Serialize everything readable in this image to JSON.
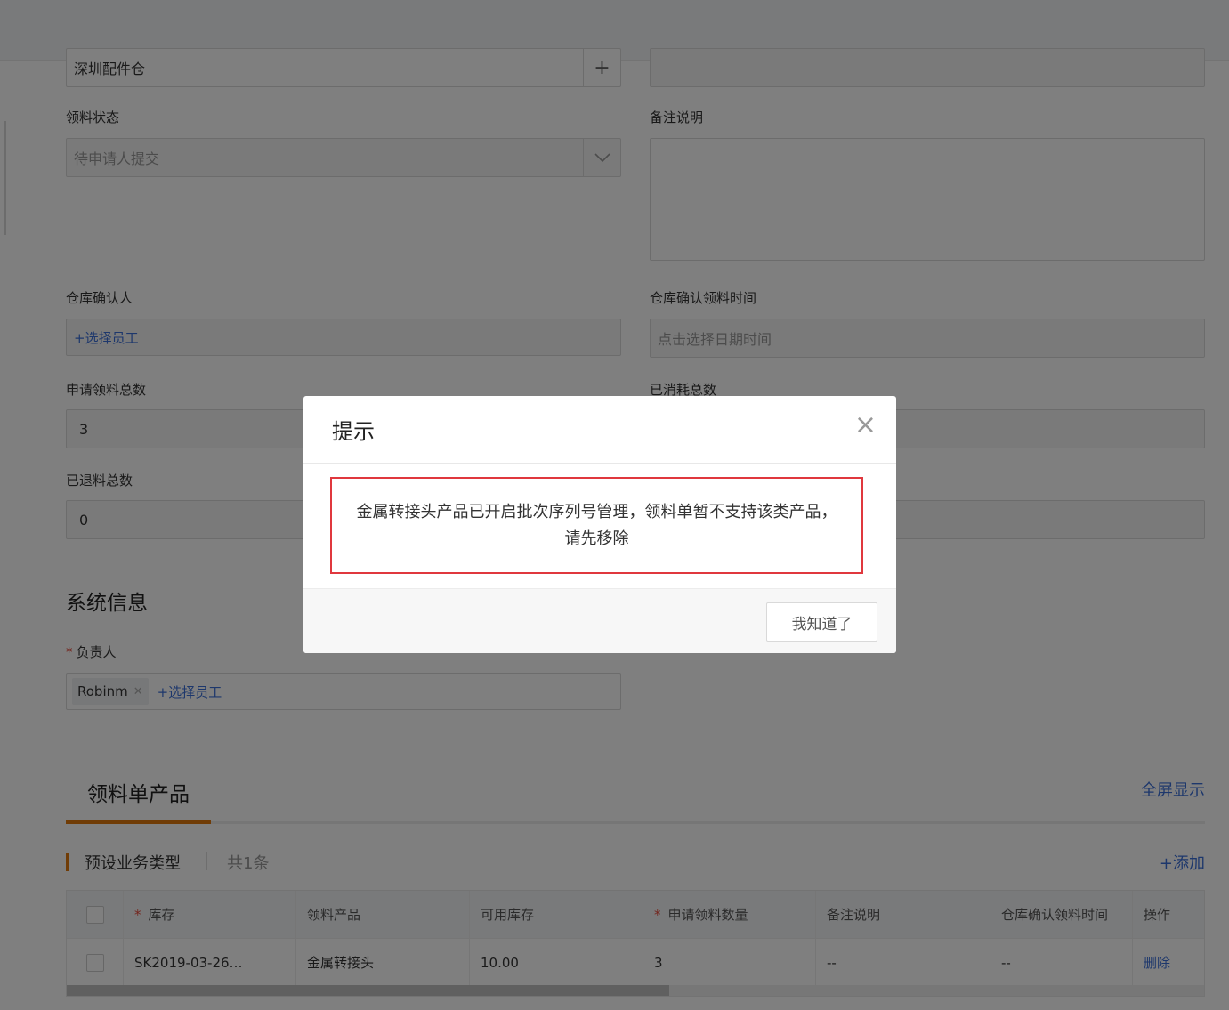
{
  "form": {
    "warehouse_value": "深圳配件仓",
    "warehouse_add": "+",
    "status_label": "领料状态",
    "status_value": "待申请人提交",
    "remark_label": "备注说明",
    "confirm_person_label": "仓库确认人",
    "confirm_person_link": "+选择员工",
    "confirm_time_label": "仓库确认领料时间",
    "confirm_time_placeholder": "点击选择日期时间",
    "total_apply_label": "申请领料总数",
    "total_apply_value": "3",
    "consumed_label": "已消耗总数",
    "returned_label": "已退料总数",
    "returned_value": "0"
  },
  "system": {
    "title": "系统信息",
    "owner_label": "负责人",
    "owner_required": "*",
    "owner_tag": "Robinm",
    "owner_tag_remove": "✕",
    "owner_link": "+选择员工"
  },
  "products": {
    "tab_label": "领料单产品",
    "fullscreen": "全屏显示",
    "subtype": "预设业务类型",
    "count": "共1条",
    "add": "+添加",
    "columns": [
      "库存",
      "领料产品",
      "可用库存",
      "申请领料数量",
      "备注说明",
      "仓库确认领料时间",
      "操作"
    ],
    "required_mark": "*",
    "rows": [
      {
        "stock": "SK2019-03-26…",
        "product": "金属转接头",
        "available": "10.00",
        "qty": "3",
        "remark": "--",
        "time": "--",
        "action": "删除"
      }
    ]
  },
  "modal": {
    "title": "提示",
    "close": "×",
    "line1": "金属转接头产品已开启批次序列号管理，领料单暂不支持该类产品，",
    "line2": "请先移除",
    "ok": "我知道了"
  },
  "colors": {
    "accent": "#e0780c",
    "link": "#3a6fd8",
    "highlight": "#e0383e"
  }
}
